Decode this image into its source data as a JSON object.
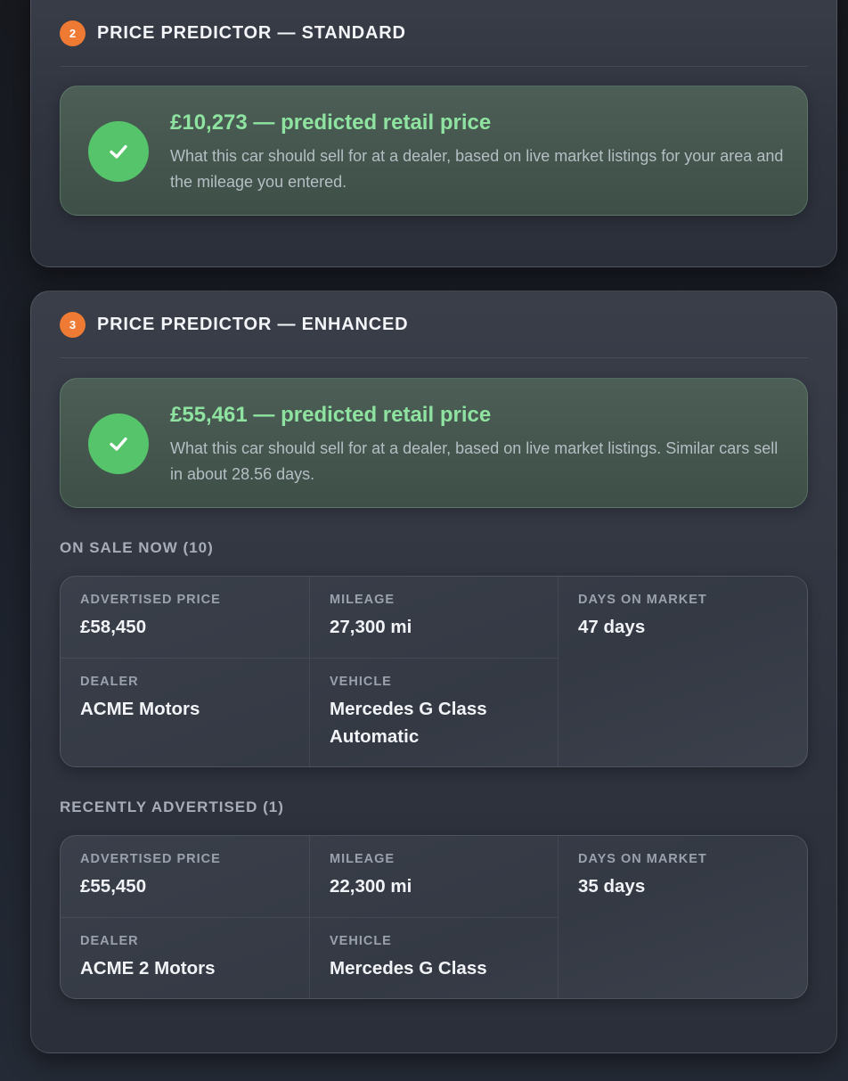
{
  "standard": {
    "step": "2",
    "title": "PRICE PREDICTOR — STANDARD",
    "result_title": "£10,273 — predicted retail price",
    "result_desc": "What this car should sell for at a dealer, based on live market listings for your area and the mileage you entered."
  },
  "enhanced": {
    "step": "3",
    "title": "PRICE PREDICTOR — ENHANCED",
    "result_title": "£55,461 — predicted retail price",
    "result_desc": "What this car should sell for at a dealer, based on live market listings. Similar cars sell in about 28.56 days.",
    "on_sale_label": "ON SALE NOW (10)",
    "recent_label": "RECENTLY ADVERTISED (1)",
    "listings": [
      {
        "price_label": "ADVERTISED PRICE",
        "price": "£58,450",
        "mileage_label": "MILEAGE",
        "mileage": "27,300 mi",
        "days_label": "DAYS ON MARKET",
        "days": "47 days",
        "dealer_label": "DEALER",
        "dealer": "ACME Motors",
        "vehicle_label": "VEHICLE",
        "vehicle": "Mercedes G Class Automatic"
      },
      {
        "price_label": "ADVERTISED PRICE",
        "price": "£55,450",
        "mileage_label": "MILEAGE",
        "mileage": "22,300 mi",
        "days_label": "DAYS ON MARKET",
        "days": "35 days",
        "dealer_label": "DEALER",
        "dealer": "ACME 2 Motors",
        "vehicle_label": "VEHICLE",
        "vehicle": "Mercedes G Class"
      }
    ]
  },
  "colors": {
    "accent_orange": "#ee7a33",
    "success_green": "#55c46b",
    "price_green": "#8ee3a0"
  },
  "icons": {
    "result": "check-icon"
  }
}
